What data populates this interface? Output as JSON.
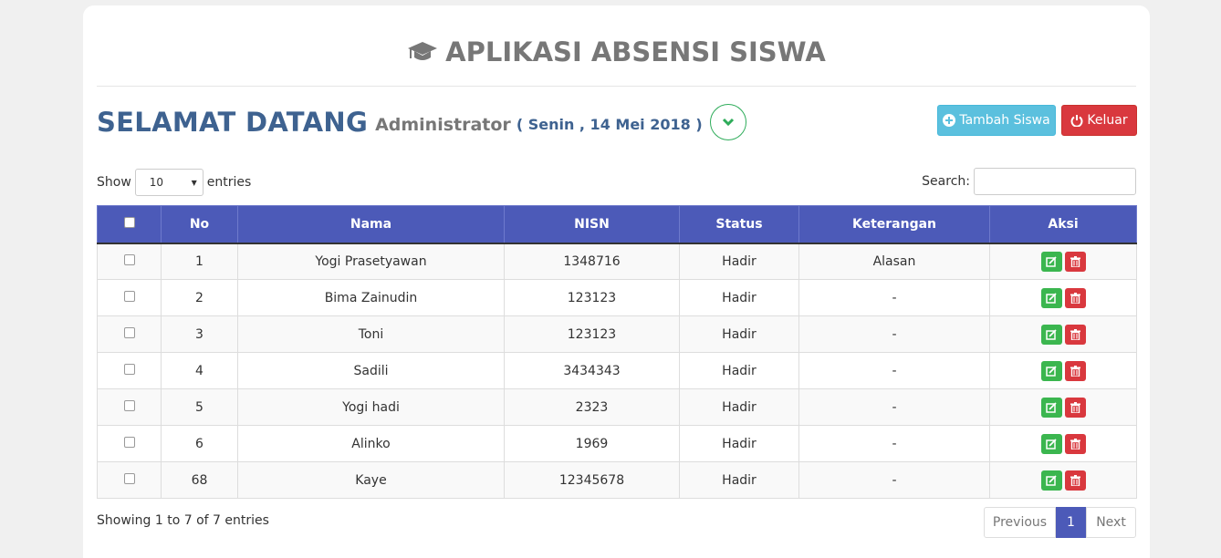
{
  "header": {
    "app_title": "APLIKASI ABSENSI SISWA"
  },
  "welcome": {
    "greeting": "SELAMAT DATANG",
    "user": "Administrator",
    "date": "( Senin , 14 Mei 2018 )"
  },
  "actions": {
    "add_label": "Tambah Siswa",
    "logout_label": "Keluar"
  },
  "table_controls": {
    "show_label": "Show",
    "entries_value": "10",
    "entries_label": "entries",
    "search_label": "Search:"
  },
  "table": {
    "columns": [
      "No",
      "Nama",
      "NISN",
      "Status",
      "Keterangan",
      "Aksi"
    ],
    "rows": [
      {
        "no": "1",
        "nama": "Yogi Prasetyawan",
        "nisn": "1348716",
        "status": "Hadir",
        "ket": "Alasan"
      },
      {
        "no": "2",
        "nama": "Bima Zainudin",
        "nisn": "123123",
        "status": "Hadir",
        "ket": "-"
      },
      {
        "no": "3",
        "nama": "Toni",
        "nisn": "123123",
        "status": "Hadir",
        "ket": "-"
      },
      {
        "no": "4",
        "nama": "Sadili",
        "nisn": "3434343",
        "status": "Hadir",
        "ket": "-"
      },
      {
        "no": "5",
        "nama": "Yogi hadi",
        "nisn": "2323",
        "status": "Hadir",
        "ket": "-"
      },
      {
        "no": "6",
        "nama": "Alinko",
        "nisn": "1969",
        "status": "Hadir",
        "ket": "-"
      },
      {
        "no": "68",
        "nama": "Kaye",
        "nisn": "12345678",
        "status": "Hadir",
        "ket": "-"
      }
    ]
  },
  "footer": {
    "info": "Showing 1 to 7 of 7 entries",
    "prev": "Previous",
    "page": "1",
    "next": "Next"
  },
  "colors": {
    "primary": "#4c5ab8",
    "title_blue": "#3e6290",
    "info": "#5bc0de",
    "danger": "#d9383e",
    "success": "#3bb64f"
  },
  "icons": [
    "graduation-cap-icon",
    "chevron-down-icon",
    "plus-circle-icon",
    "power-icon",
    "edit-icon",
    "trash-icon"
  ]
}
